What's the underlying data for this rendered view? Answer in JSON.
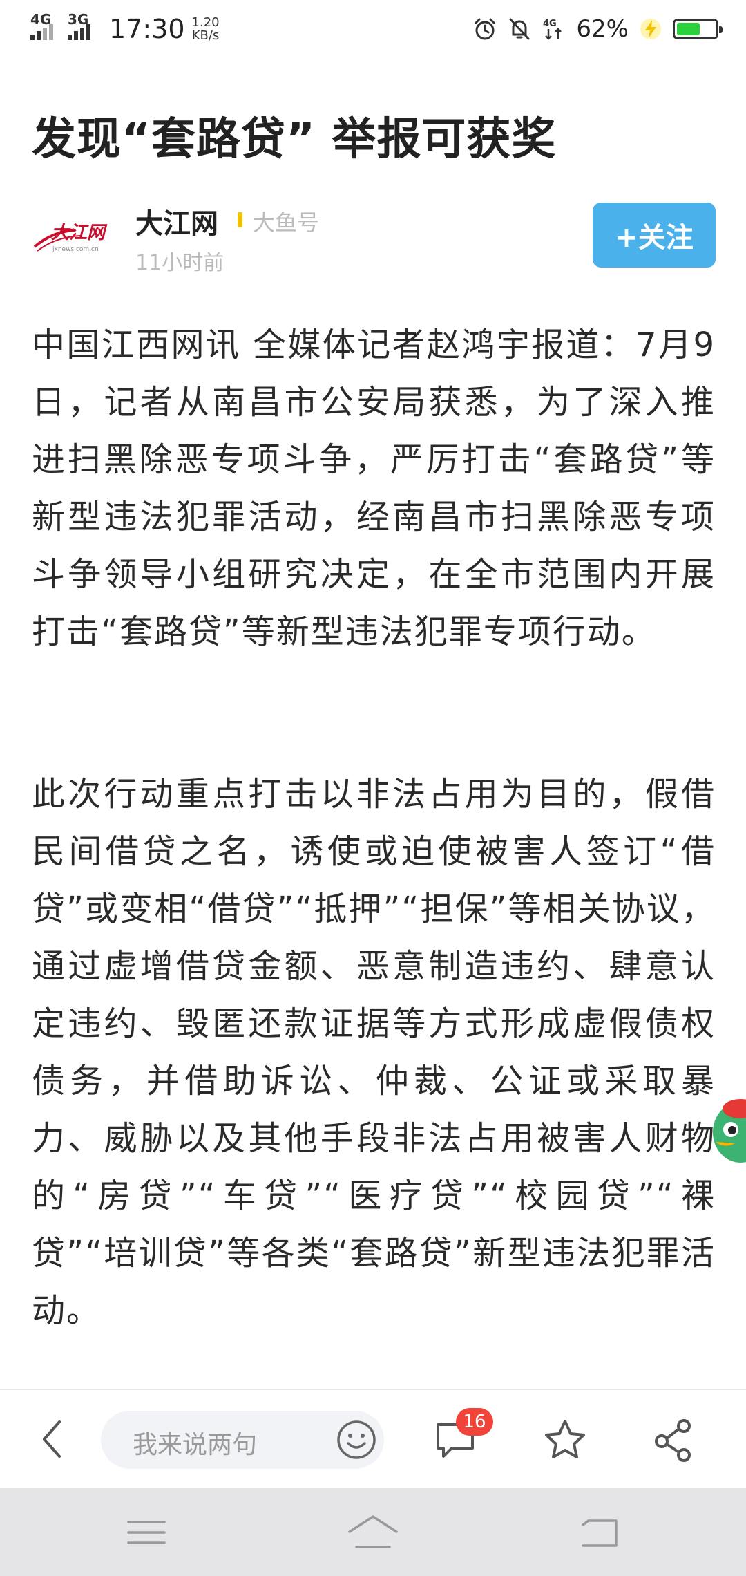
{
  "status_bar": {
    "signal1_label": "4G",
    "signal2_label": "3G",
    "time": "17:30",
    "speed_value": "1.20",
    "speed_unit": "KB/s",
    "network_label": "4G",
    "battery_percent": "62%",
    "battery_level": 0.62,
    "battery_color": "#2bd13a",
    "icons": [
      "alarm-icon",
      "mute-icon",
      "data-arrows-icon",
      "charging-icon"
    ]
  },
  "article": {
    "title": "发现“套路贷” 举报可获奖",
    "author": {
      "name": "大江网",
      "source": "大鱼号",
      "time": "11小时前",
      "follow_label": "+关注"
    },
    "paragraphs": [
      "中国江西网讯 全媒体记者赵鸿宇报道：7月9日，记者从南昌市公安局获悉，为了深入推进扫黑除恶专项斗争，严厉打击“套路贷”等新型违法犯罪活动，经南昌市扫黑除恶专项斗争领导小组研究决定，在全市范围内开展打击“套路贷”等新型违法犯罪专项行动。",
      "此次行动重点打击以非法占用为目的，假借民间借贷之名，诱使或迫使被害人签订“借贷”或变相“借贷”“抵押”“担保”等相关协议，通过虚增借贷金额、恶意制造违约、肆意认定违约、毁匿还款证据等方式形成虚假债权债务，并借助诉讼、仲裁、公证或采取暴力、威胁以及其他手段非法占用被害人财物的“房贷”“车贷”“医疗贷”“校园贷”“裸贷”“培训贷”等各类“套路贷”新型违法犯罪活动。"
    ]
  },
  "toolbar": {
    "comment_placeholder": "我来说两句",
    "comment_count": "16",
    "accent_color": "#4bb1ea",
    "badge_color": "#f0443a"
  }
}
